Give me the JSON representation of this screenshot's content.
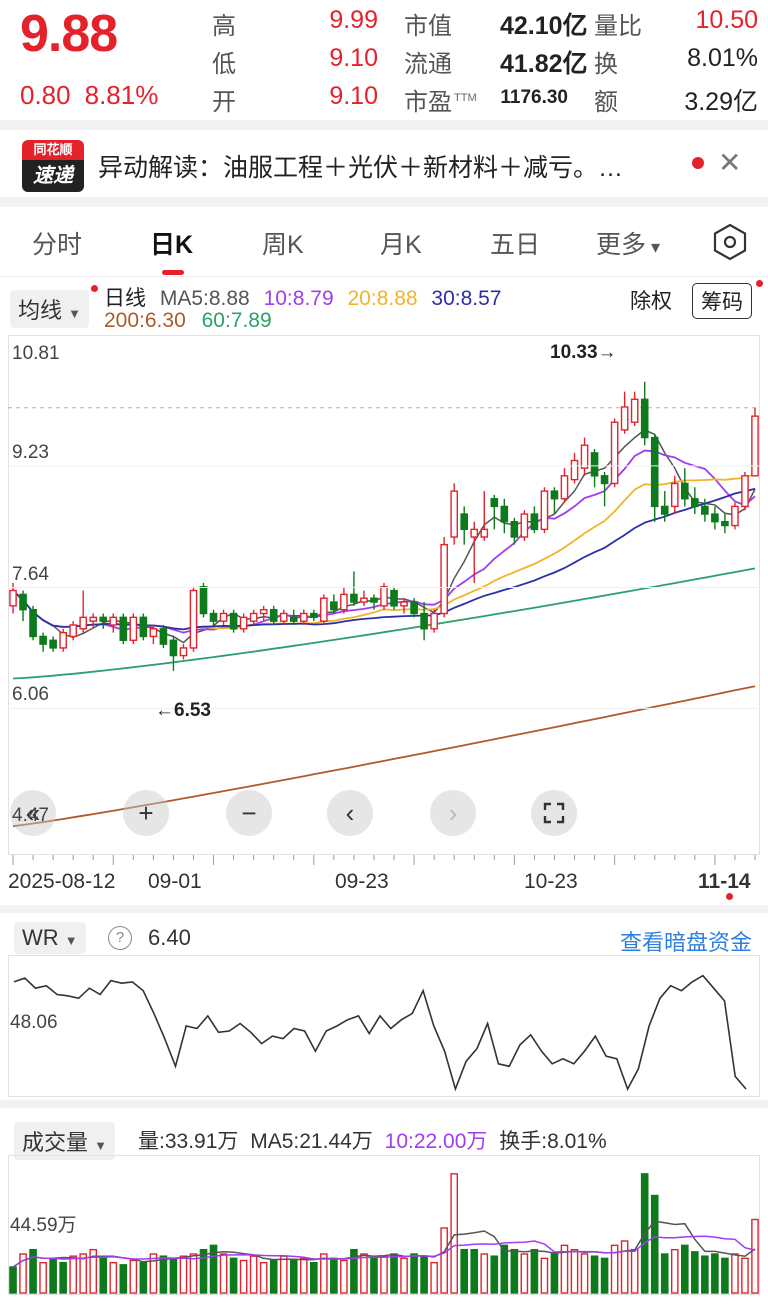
{
  "quote": {
    "price": "9.88",
    "change": "0.80",
    "change_pct": "8.81%",
    "stats": [
      {
        "label": "高",
        "value": "9.99",
        "color": "#e4222c"
      },
      {
        "label": "低",
        "value": "9.10",
        "color": "#e4222c"
      },
      {
        "label": "开",
        "value": "9.10",
        "color": "#e4222c"
      },
      {
        "label": "市值",
        "value": "42.10亿",
        "color": "#222222"
      },
      {
        "label": "流通",
        "value": "41.82亿",
        "color": "#222222"
      },
      {
        "label": "市盈",
        "sup": "TTM",
        "value": "1176.30",
        "color": "#222222"
      },
      {
        "label": "量比",
        "value": "10.50",
        "color": "#e4222c"
      },
      {
        "label": "换",
        "value": "8.01%",
        "color": "#222222"
      },
      {
        "label": "额",
        "value": "3.29亿",
        "color": "#222222"
      }
    ]
  },
  "news": {
    "logo_top": "同花顺",
    "logo_bottom": "速递",
    "text": "异动解读：油服工程＋光伏＋新材料＋减亏。…",
    "close_icon": "close-icon"
  },
  "tabs": [
    {
      "label": "分时",
      "active": false
    },
    {
      "label": "日K",
      "active": true
    },
    {
      "label": "周K",
      "active": false
    },
    {
      "label": "月K",
      "active": false
    },
    {
      "label": "五日",
      "active": false
    },
    {
      "label": "更多",
      "active": false
    }
  ],
  "settings_icon": "hexagon-settings-icon",
  "legend": {
    "indicator": "均线",
    "period": "日线",
    "ma5": "MA5:8.88",
    "ma10": "10:8.79",
    "ma20": "20:8.88",
    "ma30": "30:8.57",
    "ma200": "200:6.30",
    "ma60": "60:7.89",
    "fuquan": "除权",
    "chouma": "筹码"
  },
  "colors": {
    "up": "#e4222c",
    "down": "#0d7a1c",
    "ma5": "#555555",
    "ma10": "#a23cf0",
    "ma20": "#f0b429",
    "ma30": "#2b2fa8",
    "ma60": "#2aa06b",
    "ma200": "#b05a2a",
    "wr": "#333333"
  },
  "price_axis": [
    "10.81",
    "9.23",
    "7.64",
    "6.06",
    "4.47"
  ],
  "price_range": [
    4.47,
    10.81
  ],
  "max_label": "10.33→",
  "min_label": "←6.53",
  "dates": [
    "2025-08-12",
    "09-01",
    "09-23",
    "10-23",
    "11-14"
  ],
  "controls": [
    "rewind-icon",
    "zoom-in-icon",
    "zoom-out-icon",
    "prev-icon",
    "next-icon",
    "fullscreen-icon"
  ],
  "wr": {
    "name": "WR",
    "value": "6.40",
    "axis_label": "48.06",
    "link": "查看暗盘资金"
  },
  "volume": {
    "name": "成交量",
    "vol": "量:33.91万",
    "ma5": "MA5:21.44万",
    "ma10": "10:22.00万",
    "turnover": "换手:8.01%",
    "axis_label": "44.59万"
  },
  "chart_data": {
    "type": "candlestick",
    "candles": [
      [
        7.4,
        7.6,
        7.7,
        7.3
      ],
      [
        7.55,
        7.35,
        7.6,
        7.2
      ],
      [
        7.35,
        7.0,
        7.4,
        6.95
      ],
      [
        7.0,
        6.9,
        7.05,
        6.8
      ],
      [
        6.95,
        6.85,
        7.0,
        6.8
      ],
      [
        6.85,
        7.05,
        7.1,
        6.8
      ],
      [
        7.0,
        7.15,
        7.2,
        6.95
      ],
      [
        7.1,
        7.25,
        7.6,
        7.05
      ],
      [
        7.2,
        7.25,
        7.3,
        7.1
      ],
      [
        7.25,
        7.2,
        7.3,
        7.1
      ],
      [
        7.15,
        7.25,
        7.3,
        7.05
      ],
      [
        7.25,
        6.95,
        7.3,
        6.9
      ],
      [
        6.95,
        7.25,
        7.3,
        6.9
      ],
      [
        7.25,
        7.0,
        7.3,
        6.95
      ],
      [
        7.0,
        7.1,
        7.15,
        6.9
      ],
      [
        7.1,
        6.9,
        7.15,
        6.85
      ],
      [
        6.95,
        6.75,
        7.0,
        6.55
      ],
      [
        6.75,
        6.85,
        6.9,
        6.7
      ],
      [
        6.85,
        7.6,
        7.65,
        6.8
      ],
      [
        7.65,
        7.3,
        7.7,
        7.25
      ],
      [
        7.3,
        7.2,
        7.35,
        7.15
      ],
      [
        7.2,
        7.3,
        7.35,
        7.15
      ],
      [
        7.3,
        7.1,
        7.35,
        7.05
      ],
      [
        7.1,
        7.25,
        7.3,
        7.05
      ],
      [
        7.2,
        7.3,
        7.35,
        7.15
      ],
      [
        7.3,
        7.35,
        7.4,
        7.2
      ],
      [
        7.35,
        7.2,
        7.4,
        7.15
      ],
      [
        7.2,
        7.3,
        7.35,
        7.15
      ],
      [
        7.25,
        7.2,
        7.35,
        7.15
      ],
      [
        7.2,
        7.3,
        7.35,
        7.15
      ],
      [
        7.3,
        7.25,
        7.35,
        7.2
      ],
      [
        7.2,
        7.5,
        7.55,
        7.15
      ],
      [
        7.45,
        7.35,
        7.55,
        7.3
      ],
      [
        7.35,
        7.55,
        7.65,
        7.3
      ],
      [
        7.55,
        7.45,
        7.85,
        7.4
      ],
      [
        7.45,
        7.5,
        7.6,
        7.4
      ],
      [
        7.5,
        7.45,
        7.55,
        7.35
      ],
      [
        7.4,
        7.65,
        7.7,
        7.35
      ],
      [
        7.6,
        7.4,
        7.65,
        7.35
      ],
      [
        7.4,
        7.45,
        7.5,
        7.3
      ],
      [
        7.45,
        7.3,
        7.5,
        7.25
      ],
      [
        7.3,
        7.1,
        7.45,
        6.95
      ],
      [
        7.1,
        7.3,
        7.35,
        7.05
      ],
      [
        7.3,
        8.2,
        8.3,
        7.25
      ],
      [
        8.3,
        8.9,
        9.0,
        8.2
      ],
      [
        8.6,
        8.4,
        8.7,
        8.2
      ],
      [
        8.3,
        8.4,
        8.5,
        7.7
      ],
      [
        8.3,
        8.4,
        8.9,
        8.25
      ],
      [
        8.8,
        8.7,
        8.85,
        8.4
      ],
      [
        8.7,
        8.5,
        8.8,
        8.35
      ],
      [
        8.5,
        8.3,
        8.55,
        8.2
      ],
      [
        8.3,
        8.6,
        8.65,
        8.25
      ],
      [
        8.6,
        8.4,
        8.7,
        8.35
      ],
      [
        8.4,
        8.9,
        8.95,
        8.35
      ],
      [
        8.9,
        8.8,
        8.95,
        8.6
      ],
      [
        8.8,
        9.1,
        9.2,
        8.75
      ],
      [
        9.05,
        9.3,
        9.4,
        9.0
      ],
      [
        9.2,
        9.5,
        9.6,
        9.1
      ],
      [
        9.4,
        9.1,
        9.45,
        8.95
      ],
      [
        9.1,
        9.0,
        9.15,
        8.7
      ],
      [
        9.0,
        9.8,
        9.85,
        8.95
      ],
      [
        9.7,
        10.0,
        10.2,
        9.65
      ],
      [
        9.8,
        10.1,
        10.2,
        9.75
      ],
      [
        10.1,
        9.6,
        10.33,
        9.5
      ],
      [
        9.6,
        8.7,
        9.65,
        8.5
      ],
      [
        8.7,
        8.6,
        8.9,
        8.5
      ],
      [
        8.7,
        9.0,
        9.1,
        8.6
      ],
      [
        9.0,
        8.8,
        9.2,
        8.7
      ],
      [
        8.8,
        8.7,
        8.95,
        8.6
      ],
      [
        8.7,
        8.6,
        8.8,
        8.5
      ],
      [
        8.6,
        8.5,
        8.7,
        8.4
      ],
      [
        8.5,
        8.45,
        8.6,
        8.35
      ],
      [
        8.45,
        8.7,
        8.75,
        8.4
      ],
      [
        8.7,
        9.1,
        9.15,
        8.65
      ],
      [
        9.1,
        9.88,
        9.99,
        9.1
      ]
    ],
    "wr_values": [
      85,
      88,
      80,
      82,
      75,
      74,
      72,
      80,
      75,
      86,
      84,
      85,
      78,
      60,
      40,
      18,
      50,
      48,
      58,
      45,
      46,
      52,
      45,
      36,
      42,
      40,
      48,
      46,
      30,
      46,
      50,
      55,
      58,
      44,
      58,
      48,
      55,
      60,
      78,
      50,
      30,
      0,
      22,
      32,
      52,
      20,
      18,
      35,
      43,
      30,
      20,
      24,
      20,
      30,
      42,
      26,
      24,
      0,
      16,
      50,
      72,
      82,
      78,
      85,
      90,
      80,
      70,
      10,
      0
    ],
    "volume": [
      12,
      18,
      20,
      14,
      16,
      14,
      17,
      18,
      20,
      16,
      14,
      13,
      15,
      14,
      18,
      17,
      16,
      17,
      18,
      20,
      22,
      18,
      16,
      15,
      17,
      14,
      15,
      17,
      15,
      16,
      14,
      18,
      16,
      15,
      20,
      18,
      16,
      17,
      18,
      16,
      18,
      17,
      14,
      30,
      55,
      20,
      20,
      18,
      17,
      22,
      20,
      18,
      20,
      16,
      18,
      22,
      20,
      18,
      17,
      16,
      22,
      24,
      20,
      55,
      45,
      18,
      20,
      22,
      19,
      17,
      18,
      16,
      18,
      16,
      33.91
    ],
    "volume_up": [
      false,
      true,
      false,
      true,
      false,
      false,
      true,
      true,
      true,
      false,
      true,
      false,
      true,
      false,
      true,
      false,
      false,
      true,
      true,
      false,
      false,
      true,
      false,
      true,
      true,
      true,
      false,
      true,
      false,
      true,
      false,
      true,
      false,
      true,
      false,
      true,
      false,
      true,
      false,
      true,
      false,
      false,
      true,
      true,
      true,
      false,
      false,
      true,
      false,
      false,
      false,
      true,
      false,
      true,
      false,
      true,
      true,
      true,
      false,
      false,
      true,
      true,
      true,
      false,
      false,
      false,
      true,
      false,
      false,
      false,
      false,
      false,
      true,
      true,
      true
    ]
  }
}
